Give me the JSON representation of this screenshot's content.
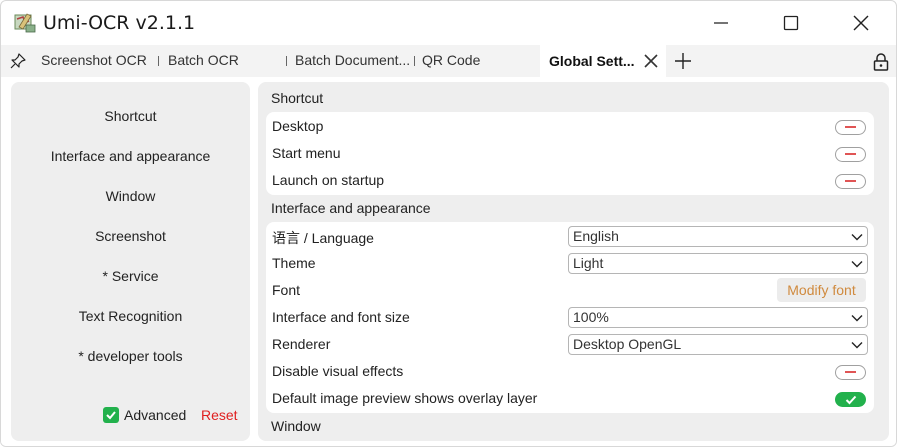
{
  "window": {
    "title": "Umi-OCR v2.1.1"
  },
  "tabs": [
    {
      "label": "Screenshot OCR"
    },
    {
      "label": "Batch OCR"
    },
    {
      "label": "Batch Document..."
    },
    {
      "label": "QR Code"
    },
    {
      "label": "Global Sett..."
    }
  ],
  "sidebar": {
    "items": [
      {
        "label": "Shortcut"
      },
      {
        "label": "Interface and appearance"
      },
      {
        "label": "Window"
      },
      {
        "label": "Screenshot"
      },
      {
        "label": "* Service"
      },
      {
        "label": "Text Recognition"
      },
      {
        "label": "* developer tools"
      }
    ],
    "advanced_label": "Advanced",
    "advanced_checked": true,
    "reset_label": "Reset"
  },
  "shortcut": {
    "title": "Shortcut",
    "rows": [
      {
        "label": "Desktop",
        "enabled": false
      },
      {
        "label": "Start menu",
        "enabled": false
      },
      {
        "label": "Launch on startup",
        "enabled": false
      }
    ]
  },
  "appearance": {
    "title": "Interface and appearance",
    "language": {
      "label": "语言 / Language",
      "value": "English"
    },
    "theme": {
      "label": "Theme",
      "value": "Light"
    },
    "font": {
      "label": "Font",
      "button": "Modify font"
    },
    "font_size": {
      "label": "Interface and font size",
      "value": "100%"
    },
    "renderer": {
      "label": "Renderer",
      "value": "Desktop OpenGL"
    },
    "visual_effects": {
      "label": "Disable visual effects",
      "enabled": false
    },
    "overlay": {
      "label": "Default image preview shows overlay layer",
      "enabled": true
    }
  },
  "window_section": {
    "title": "Window"
  },
  "colors": {
    "accent_green": "#22b14c",
    "reset_red": "#e02020",
    "font_button_orange": "#d08a3e",
    "panel_gray": "#eeeeee"
  }
}
